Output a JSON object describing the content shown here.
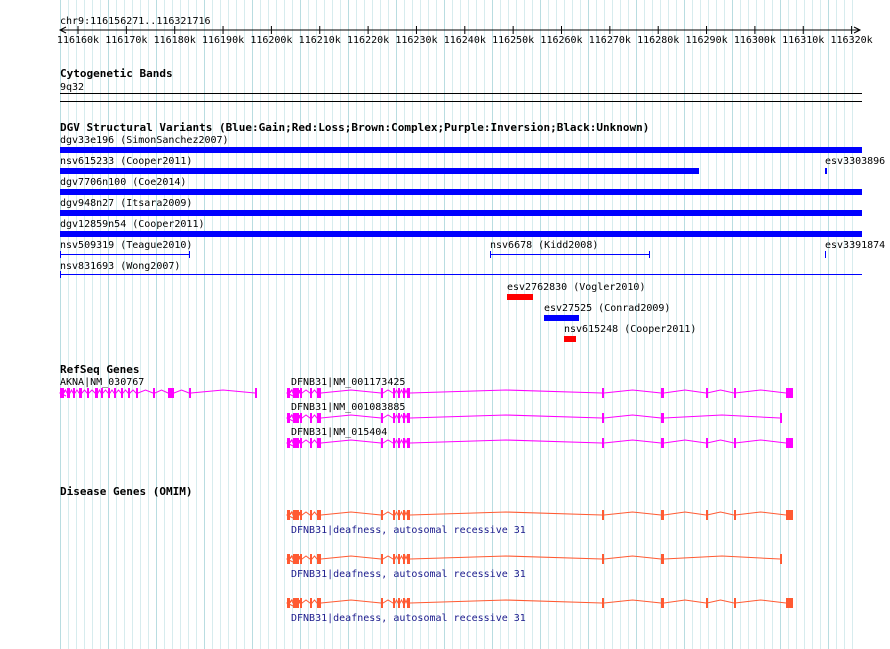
{
  "location": "chr9:116156271..116321716",
  "ruler": {
    "ticks": [
      "116160k",
      "116170k",
      "116180k",
      "116190k",
      "116200k",
      "116210k",
      "116220k",
      "116230k",
      "116240k",
      "116250k",
      "116260k",
      "116270k",
      "116280k",
      "116290k",
      "116300k",
      "116310k",
      "116320k"
    ]
  },
  "colors": {
    "gain": "#0000ff",
    "loss": "#ff0000",
    "refseq": "#ff00ff",
    "omim": "#ff5a32",
    "grid": "#d7ecee"
  },
  "tracks": {
    "cytoband": {
      "title": "Cytogenetic Bands",
      "band": "9q32"
    },
    "dgv": {
      "title": "DGV Structural Variants (Blue:Gain;Red:Loss;Brown:Complex;Purple:Inversion;Black:Unknown)",
      "features": [
        {
          "label": "dgv33e196 (SimonSanchez2007)"
        },
        {
          "label": "nsv615233 (Cooper2011)"
        },
        {
          "label": "esv3303896"
        },
        {
          "label": "dgv7706n100 (Coe2014)"
        },
        {
          "label": "dgv948n27 (Itsara2009)"
        },
        {
          "label": "dgv12859n54 (Cooper2011)"
        },
        {
          "label": "nsv509319 (Teague2010)"
        },
        {
          "label": "nsv6678 (Kidd2008)"
        },
        {
          "label": "esv3391874"
        },
        {
          "label": "nsv831693 (Wong2007)"
        },
        {
          "label": "esv2762830 (Vogler2010)"
        },
        {
          "label": "esv27525 (Conrad2009)"
        },
        {
          "label": "nsv615248 (Cooper2011)"
        }
      ]
    },
    "refseq": {
      "title": "RefSeq Genes",
      "genes": [
        {
          "label": "AKNA|NM_030767"
        },
        {
          "label": "DFNB31|NM_001173425"
        },
        {
          "label": "DFNB31|NM_001083885"
        },
        {
          "label": "DFNB31|NM_015404"
        }
      ]
    },
    "omim": {
      "title": "Disease Genes (OMIM)",
      "genes": [
        {
          "label": "DFNB31|deafness, autosomal recessive 31"
        },
        {
          "label": "DFNB31|deafness, autosomal recessive 31"
        },
        {
          "label": "DFNB31|deafness, autosomal recessive 31"
        }
      ]
    }
  }
}
